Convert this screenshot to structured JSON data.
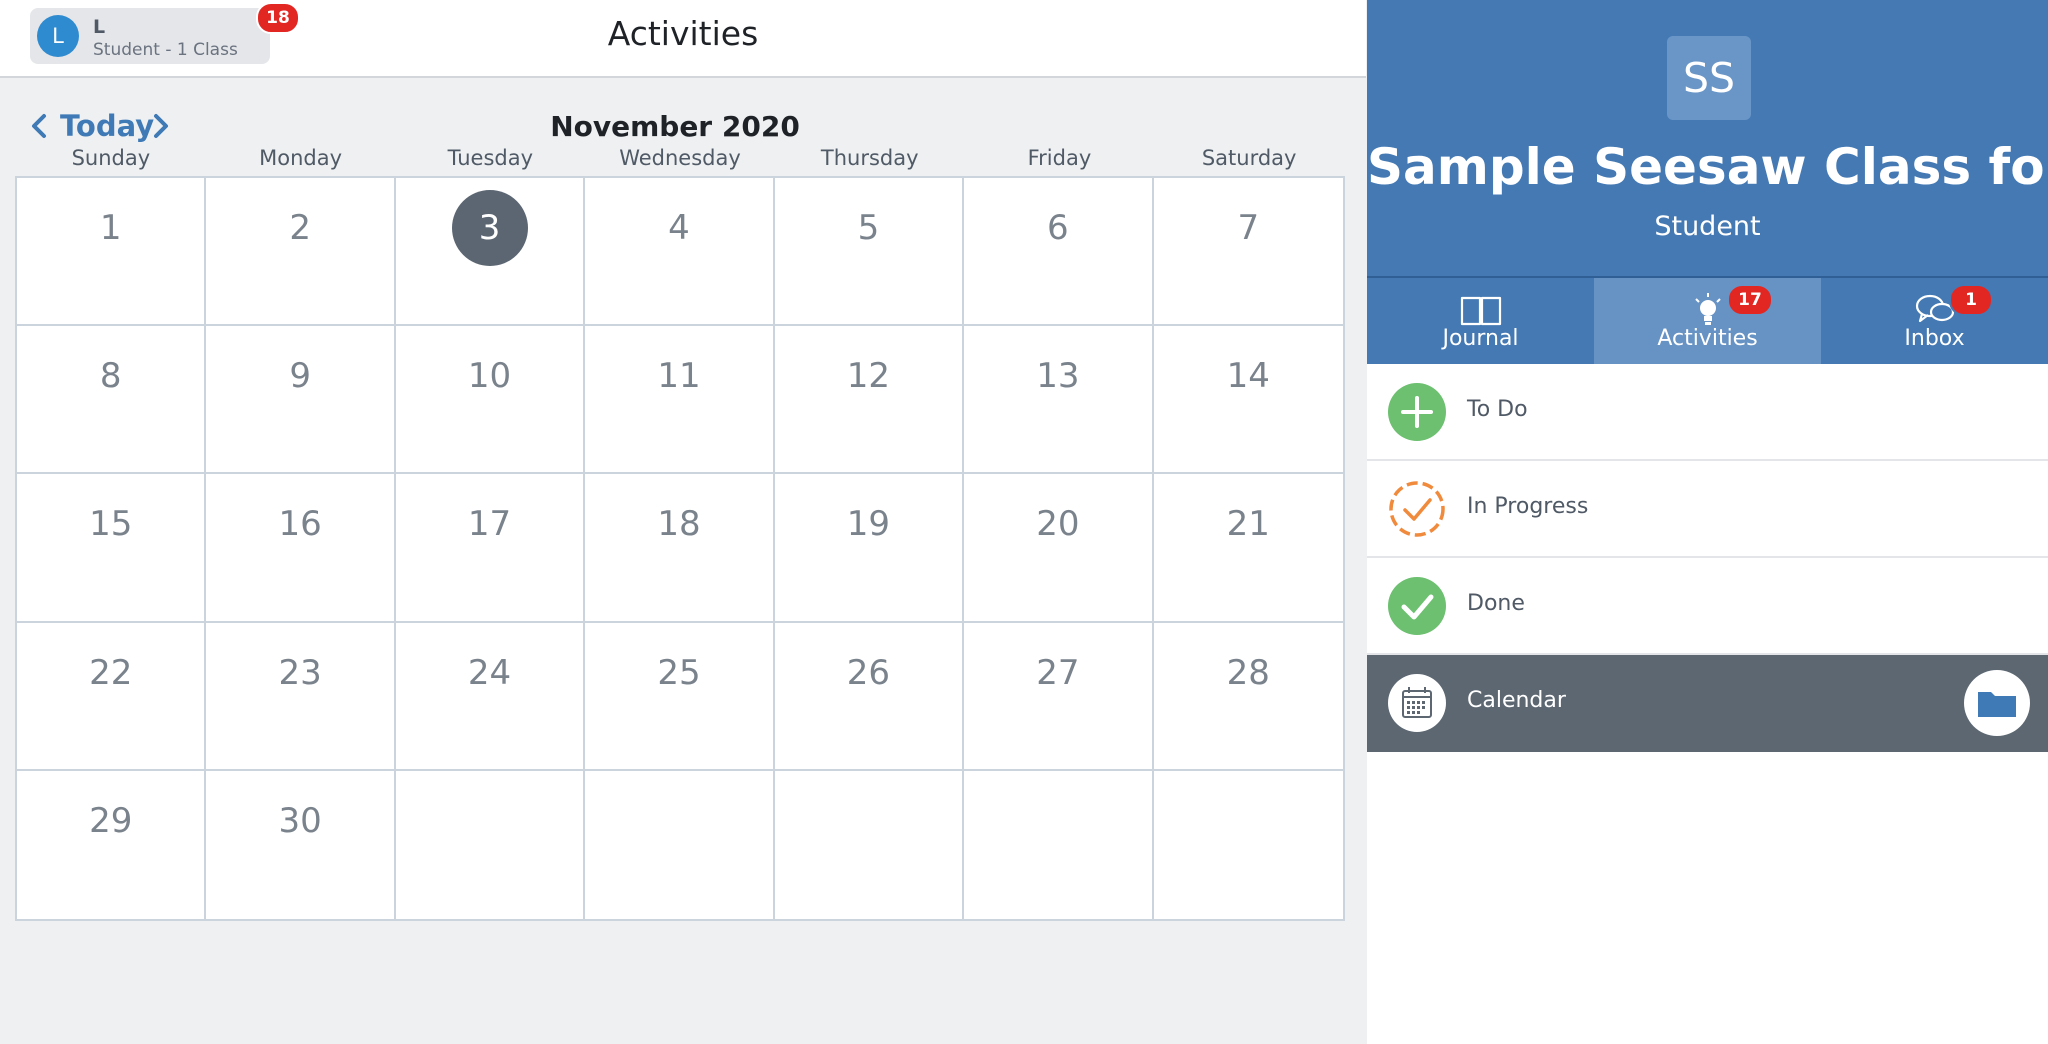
{
  "topbar": {
    "user_initial": "L",
    "user_name": "L",
    "user_subtitle": "Student - 1 Class",
    "notifications_badge": "18",
    "page_title": "Activities"
  },
  "calendar": {
    "today_label": "Today",
    "month_title": "November 2020",
    "weekdays": [
      "Sunday",
      "Monday",
      "Tuesday",
      "Wednesday",
      "Thursday",
      "Friday",
      "Saturday"
    ],
    "weeks": [
      [
        "1",
        "2",
        "3",
        "4",
        "5",
        "6",
        "7"
      ],
      [
        "8",
        "9",
        "10",
        "11",
        "12",
        "13",
        "14"
      ],
      [
        "15",
        "16",
        "17",
        "18",
        "19",
        "20",
        "21"
      ],
      [
        "22",
        "23",
        "24",
        "25",
        "26",
        "27",
        "28"
      ],
      [
        "29",
        "30",
        "",
        "",
        "",
        "",
        ""
      ]
    ],
    "selected_day": "3"
  },
  "sidebar": {
    "class_avatar": "SS",
    "class_name": "Sample Seesaw Class for ...",
    "class_role": "Student",
    "tabs": [
      {
        "label": "Journal",
        "icon": "journal-book-icon"
      },
      {
        "label": "Activities",
        "icon": "lightbulb-icon",
        "badge": "17"
      },
      {
        "label": "Inbox",
        "icon": "chat-bubbles-icon",
        "badge": "1"
      }
    ],
    "statuses": [
      {
        "label": "To Do",
        "icon": "plus-circle-icon"
      },
      {
        "label": "In Progress",
        "icon": "dashed-check-circle-icon"
      },
      {
        "label": "Done",
        "icon": "check-circle-icon"
      },
      {
        "label": "Calendar",
        "icon": "calendar-icon"
      }
    ]
  },
  "colors": {
    "brand_blue": "#4479b3",
    "active_tab": "#6692c4",
    "badge_red": "#e22723",
    "todo_green": "#6cc070",
    "progress_orange": "#f08a3c",
    "today_circle": "#5b6672"
  }
}
